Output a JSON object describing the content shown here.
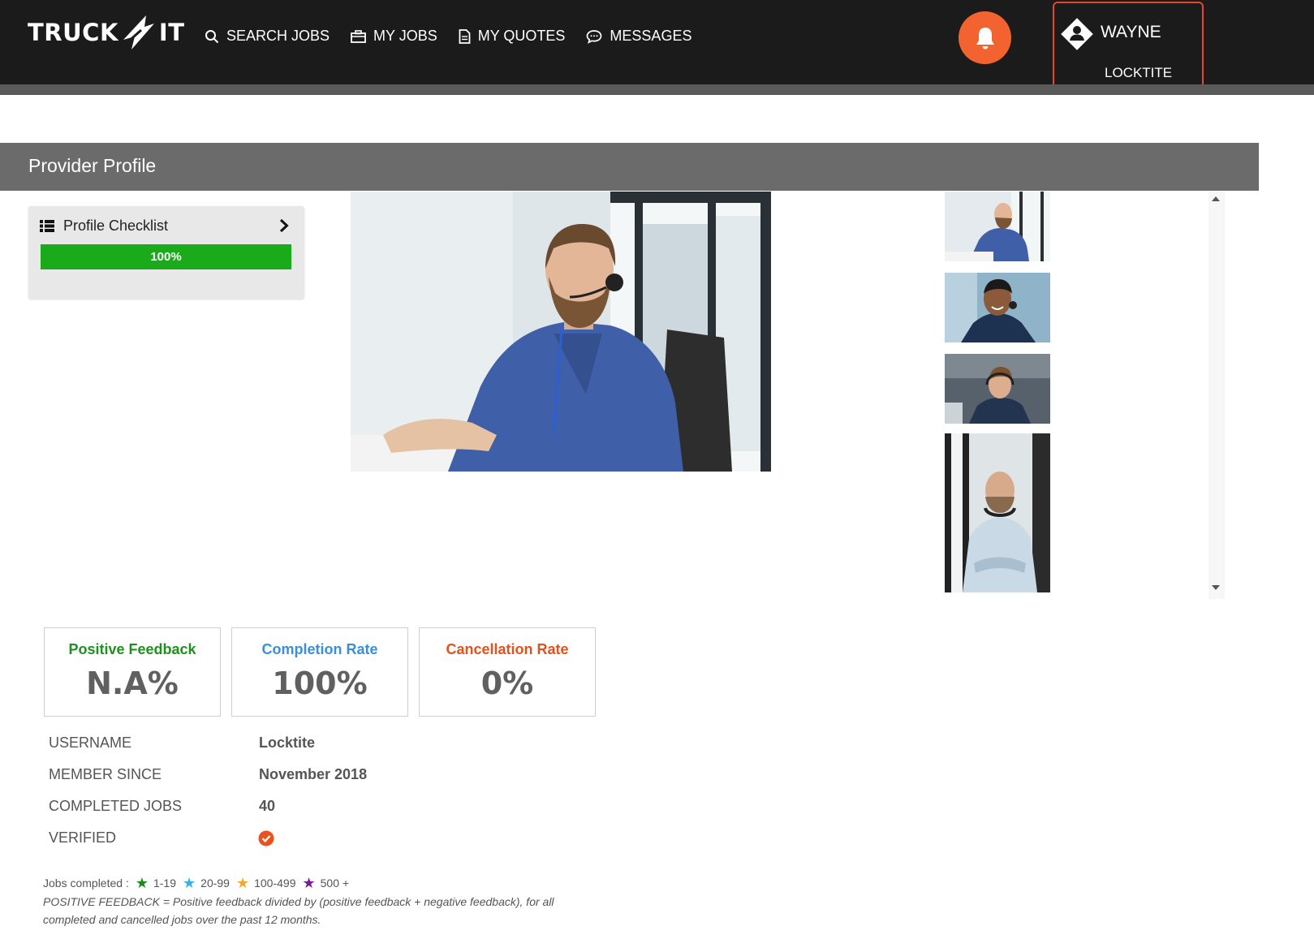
{
  "brand": {
    "left": "TRUCK",
    "right": "IT"
  },
  "nav": {
    "items": [
      {
        "label": "SEARCH JOBS",
        "icon": "search-icon"
      },
      {
        "label": "MY JOBS",
        "icon": "briefcase-icon"
      },
      {
        "label": "MY QUOTES",
        "icon": "document-icon"
      },
      {
        "label": "MESSAGES",
        "icon": "chat-bubble-icon"
      }
    ],
    "accent_color": "#f26330"
  },
  "user": {
    "name": "WAYNE",
    "company": "LOCKTITE"
  },
  "section": {
    "title": "Provider Profile"
  },
  "checklist": {
    "label": "Profile Checklist",
    "progress_percent": 100,
    "progress_text": "100%"
  },
  "gallery": {
    "main_photo": "man-with-headset-at-desk",
    "thumbnails": [
      "man-with-headset-at-desk",
      "smiling-man-with-headset",
      "man-with-headset-at-computer",
      "man-with-headphones-arms-crossed"
    ]
  },
  "stats": [
    {
      "title": "Positive Feedback",
      "value": "N.A%",
      "color": "#1f8f1f"
    },
    {
      "title": "Completion Rate",
      "value": "100%",
      "color": "#3a8fd6"
    },
    {
      "title": "Cancellation Rate",
      "value": "0%",
      "color": "#e0521f"
    }
  ],
  "details": [
    {
      "label": "USERNAME",
      "value": "Locktite"
    },
    {
      "label": "MEMBER SINCE",
      "value": "November 2018"
    },
    {
      "label": "COMPLETED JOBS",
      "value": "40"
    },
    {
      "label": "VERIFIED",
      "value": ""
    }
  ],
  "legend": {
    "prefix": "Jobs completed :",
    "tiers": [
      {
        "range": "1-19",
        "color": "#1a8a1a"
      },
      {
        "range": "20-99",
        "color": "#3ab0e0"
      },
      {
        "range": "100-499",
        "color": "#f0a830"
      },
      {
        "range": "500 +",
        "color": "#7a1a9a"
      }
    ]
  },
  "footnote": "POSITIVE FEEDBACK = Positive feedback divided by (positive feedback + negative feedback), for all completed and cancelled jobs over the past 12 months."
}
